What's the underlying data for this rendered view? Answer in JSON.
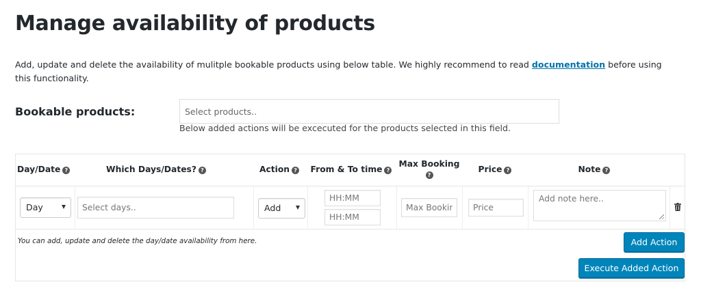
{
  "page": {
    "title": "Manage availability of products",
    "intro_before_link": "Add, update and delete the availability of mulitple bookable products using below table. We highly recommend to read ",
    "intro_link": "documentation",
    "intro_after_link": " before using this functionality."
  },
  "bookable": {
    "label": "Bookable products:",
    "placeholder": "Select products..",
    "help": "Below added actions will be excecuted for the products selected in this field."
  },
  "table": {
    "headers": {
      "day_date": "Day/Date",
      "which_days": "Which Days/Dates?",
      "action": "Action",
      "from_to": "From & To time",
      "max_booking": "Max Booking",
      "price": "Price",
      "note": "Note"
    },
    "row": {
      "day_date_value": "Day",
      "which_days_placeholder": "Select days..",
      "action_value": "Add",
      "from_placeholder": "HH:MM",
      "to_placeholder": "HH:MM",
      "max_booking_placeholder": "Max Booking",
      "price_placeholder": "Price",
      "note_placeholder": "Add note here.."
    },
    "footer_note": "You can add, update and delete the day/date availability from here.",
    "add_action_label": "Add Action",
    "execute_label": "Execute Added Action"
  },
  "icons": {
    "help": "help-circle-icon",
    "caret": "chevron-down-icon",
    "delete": "trash-icon"
  },
  "colors": {
    "primary_button": "#0085ba",
    "link": "#0073aa"
  }
}
